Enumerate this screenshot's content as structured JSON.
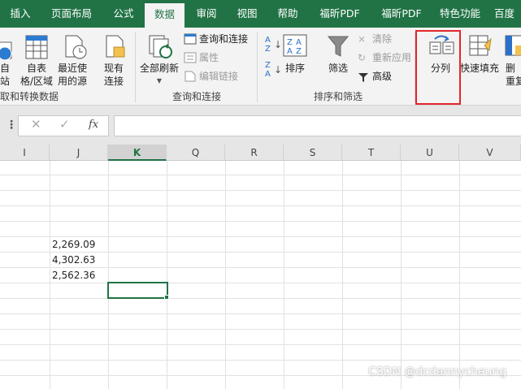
{
  "tabs": [
    "插入",
    "页面布局",
    "公式",
    "数据",
    "审阅",
    "视图",
    "帮助",
    "福昕PDF",
    "福昕PDF",
    "特色功能",
    "百度"
  ],
  "active_tab": "数据",
  "ribbon": {
    "get_transform": {
      "btn_web_line1": "自",
      "btn_web_line2": "站",
      "btn_table_line1": "自表",
      "btn_table_line2": "格/区域",
      "btn_recent_line1": "最近使",
      "btn_recent_line2": "用的源",
      "btn_existing_line1": "现有",
      "btn_existing_line2": "连接",
      "label": "取和转换数据"
    },
    "queries": {
      "refresh_all": "全部刷新",
      "queries_connections": "查询和连接",
      "properties": "属性",
      "edit_links": "编辑链接",
      "label": "查询和连接"
    },
    "sort_filter": {
      "sort": "排序",
      "filter": "筛选",
      "clear": "清除",
      "reapply": "重新应用",
      "advanced": "高级",
      "label": "排序和筛选"
    },
    "data_tools": {
      "text_to_columns": "分列",
      "flash_fill": "快速填充",
      "remove_dup_line1": "删",
      "remove_dup_line2": "重复"
    }
  },
  "formula_bar": {
    "cancel": "✕",
    "enter": "✓",
    "fx": "fx",
    "value": ""
  },
  "columns": [
    "I",
    "J",
    "K",
    "Q",
    "R",
    "S",
    "T",
    "U",
    "V"
  ],
  "selected_column": "K",
  "cells": {
    "j_row6": "2,269.09",
    "j_row7": "4,302.63",
    "j_row8": "2,562.36"
  },
  "watermark": "CSDN @dcdannycheung",
  "colors": {
    "accent": "#217346",
    "highlight": "#e3262b"
  }
}
